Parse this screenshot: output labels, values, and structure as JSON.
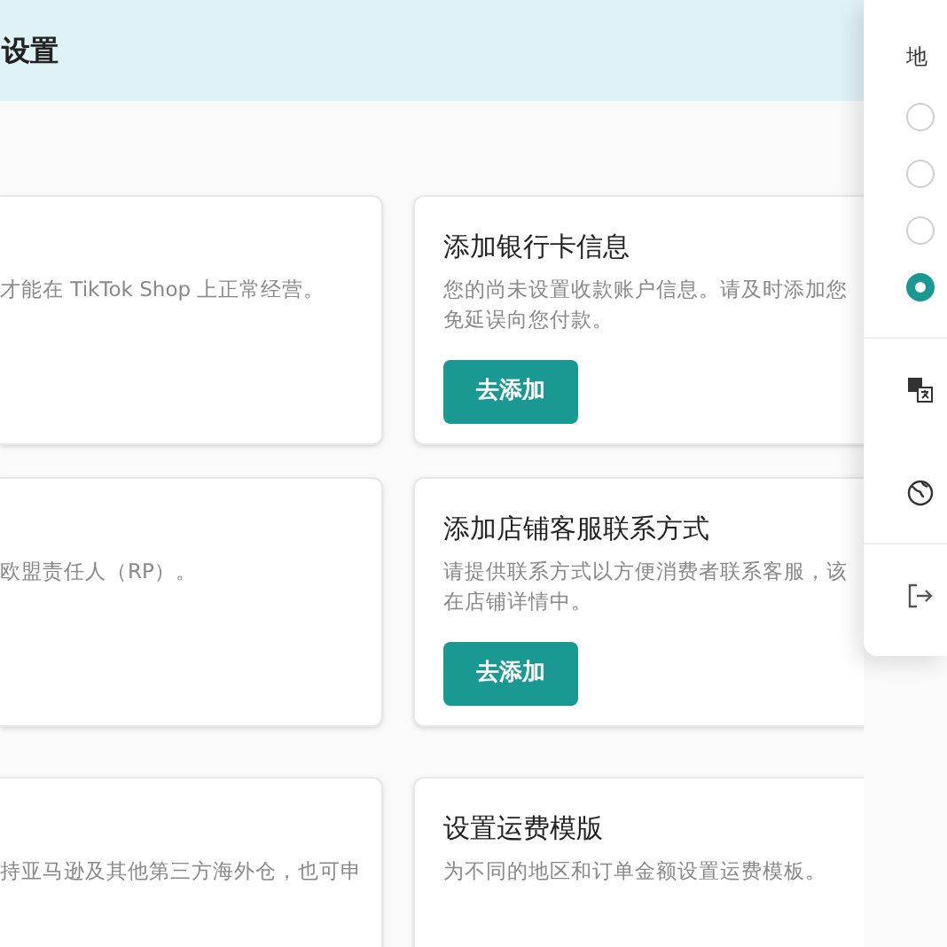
{
  "header": {
    "title": "设置"
  },
  "cards": [
    {
      "description": [
        "才能在 TikTok Shop 上正常经营。"
      ]
    },
    {
      "title": "添加银行卡信息",
      "description": [
        "您的尚未设置收款账户信息。请及时添加您",
        "免延误向您付款。"
      ],
      "button": "去添加"
    },
    {
      "description": [
        "欧盟责任人（RP）。"
      ]
    },
    {
      "title": "添加店铺客服联系方式",
      "description": [
        "请提供联系方式以方便消费者联系客服，该",
        "在店铺详情中。"
      ],
      "button": "去添加"
    },
    {
      "description": [
        "持亚马逊及其他第三方海外仓，也可申"
      ]
    },
    {
      "title": "设置运费模版",
      "description": [
        "为不同的地区和订单金额设置运费模板。"
      ]
    }
  ],
  "menu": {
    "region_label": "地",
    "radios": [
      {
        "selected": false
      },
      {
        "selected": false
      },
      {
        "selected": false
      },
      {
        "selected": true
      }
    ],
    "items": [
      {
        "kind": "language"
      },
      {
        "kind": "globe"
      },
      {
        "kind": "logout"
      }
    ]
  }
}
